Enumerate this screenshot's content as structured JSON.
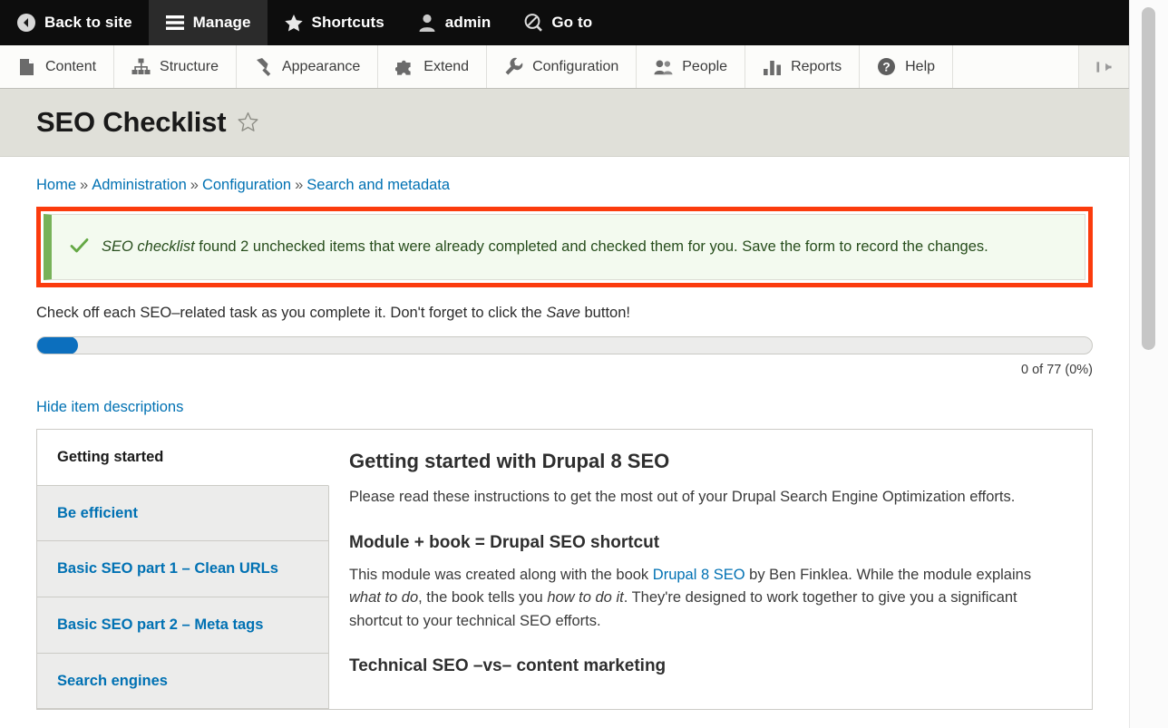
{
  "admin_bar": {
    "items": [
      {
        "label": "Back to site",
        "icon": "back-arrow-circle-icon",
        "active": false
      },
      {
        "label": "Manage",
        "icon": "hamburger-icon",
        "active": true
      },
      {
        "label": "Shortcuts",
        "icon": "star-icon",
        "active": false
      },
      {
        "label": "admin",
        "icon": "user-icon",
        "active": false
      },
      {
        "label": "Go to",
        "icon": "search-circle-icon",
        "active": false
      }
    ]
  },
  "tray_bar": {
    "items": [
      {
        "label": "Content",
        "icon": "document-icon"
      },
      {
        "label": "Structure",
        "icon": "sitemap-icon"
      },
      {
        "label": "Appearance",
        "icon": "paintbrush-icon"
      },
      {
        "label": "Extend",
        "icon": "puzzle-piece-icon"
      },
      {
        "label": "Configuration",
        "icon": "wrench-icon"
      },
      {
        "label": "People",
        "icon": "people-icon"
      },
      {
        "label": "Reports",
        "icon": "bar-chart-icon"
      },
      {
        "label": "Help",
        "icon": "question-mark-circle-icon"
      }
    ],
    "collapse_icon": "collapse-left-icon"
  },
  "header": {
    "title": "SEO Checklist",
    "favorite_icon": "star-outline-icon"
  },
  "breadcrumb": {
    "separator": "»",
    "items": [
      {
        "label": "Home"
      },
      {
        "label": "Administration"
      },
      {
        "label": "Configuration"
      },
      {
        "label": "Search and metadata"
      }
    ]
  },
  "status_message": {
    "icon": "check-icon",
    "emphasis": "SEO checklist",
    "text": " found 2 unchecked items that were already completed and checked them for you. Save the form to record the changes.",
    "found_count": 2,
    "border_color": "#fb3b0d",
    "accent_color": "#77b259",
    "background_color": "#f3faef"
  },
  "instructions": {
    "before": "Check off each SEO–related task as you complete it. Don't forget to click the ",
    "emphasis": "Save",
    "after": " button!"
  },
  "progress": {
    "completed": 0,
    "total": 77,
    "percent": 0,
    "label": "0 of 77 (0%)",
    "fill_color": "#0c6fbe"
  },
  "toggle_descriptions": {
    "label": "Hide item descriptions"
  },
  "vertical_tabs": {
    "items": [
      {
        "label": "Getting started",
        "selected": true
      },
      {
        "label": "Be efficient",
        "selected": false
      },
      {
        "label": "Basic SEO part 1 – Clean URLs",
        "selected": false
      },
      {
        "label": "Basic SEO part 2 – Meta tags",
        "selected": false
      },
      {
        "label": "Search engines",
        "selected": false
      }
    ],
    "pane": {
      "heading": "Getting started with Drupal 8 SEO",
      "intro": "Please read these instructions to get the most out of your Drupal Search Engine Optimization efforts.",
      "subheading_1": "Module + book = Drupal SEO shortcut",
      "body_1_before": "This module was created along with the book ",
      "body_1_link": "Drupal 8 SEO",
      "body_1_mid": " by Ben Finklea. While the module explains ",
      "body_1_em_1": "what to do",
      "body_1_mid_2": ", the book tells you ",
      "body_1_em_2": "how to do it",
      "body_1_after": ". They're designed to work together to give you a significant shortcut to your technical SEO efforts.",
      "subheading_2": "Technical SEO –vs– content marketing"
    }
  },
  "scrollbar": {
    "orientation": "vertical"
  }
}
